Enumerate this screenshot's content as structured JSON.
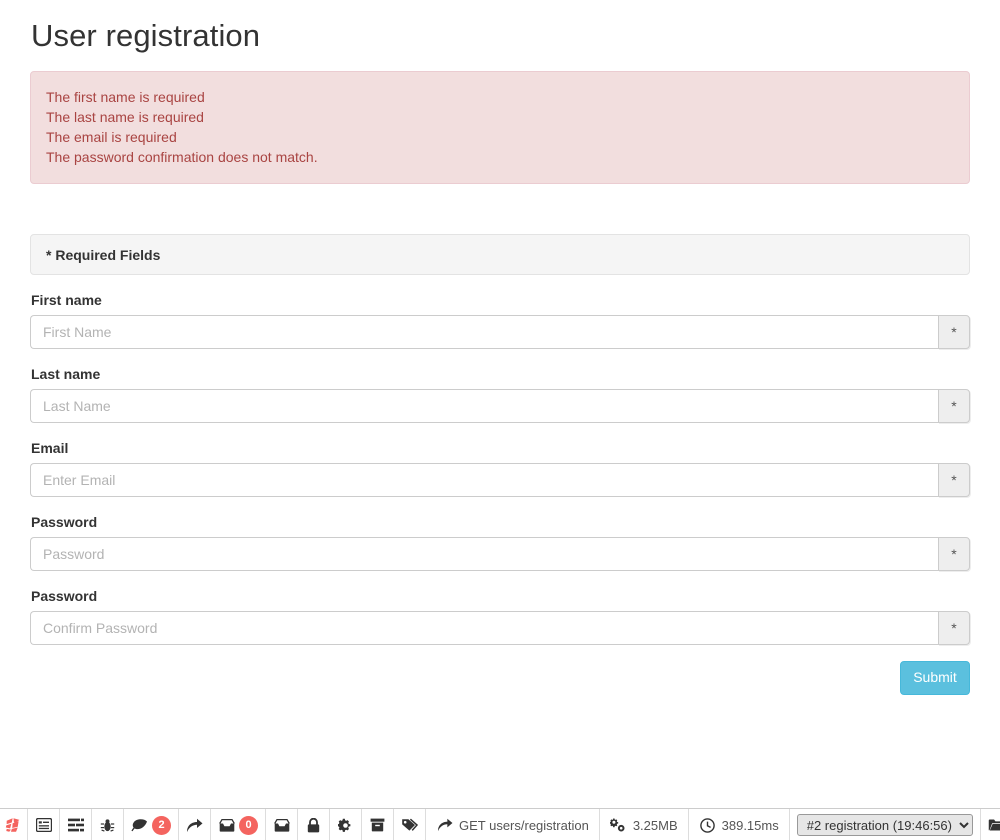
{
  "page": {
    "title": "User registration"
  },
  "alert": {
    "errors": [
      "The first name is required",
      "The last name is required",
      "The email is required",
      "The password confirmation does not match."
    ],
    "bg_color": "#f2dede",
    "text_color": "#a94442"
  },
  "panel": {
    "required_fields_label": "* Required Fields"
  },
  "form": {
    "fields": [
      {
        "label": "First name",
        "placeholder": "First Name",
        "value": "",
        "addon": "*",
        "type": "text",
        "name": "first-name"
      },
      {
        "label": "Last name",
        "placeholder": "Last Name",
        "value": "",
        "addon": "*",
        "type": "text",
        "name": "last-name"
      },
      {
        "label": "Email",
        "placeholder": "Enter Email",
        "value": "",
        "addon": "*",
        "type": "email",
        "name": "email"
      },
      {
        "label": "Password",
        "placeholder": "Password",
        "value": "",
        "addon": "*",
        "type": "password",
        "name": "password"
      },
      {
        "label": "Password",
        "placeholder": "Confirm Password",
        "value": "",
        "addon": "*",
        "type": "password",
        "name": "confirm-password"
      }
    ],
    "submit_label": "Submit",
    "submit_color": "#5bc0de"
  },
  "debugbar": {
    "icons": [
      {
        "name": "debugbar-logo-icon",
        "glyph": "logo",
        "badge": null
      },
      {
        "name": "messages-icon",
        "glyph": "list",
        "badge": null
      },
      {
        "name": "timeline-icon",
        "glyph": "tasks",
        "badge": null
      },
      {
        "name": "exceptions-icon",
        "glyph": "bug",
        "badge": null
      },
      {
        "name": "views-icon",
        "glyph": "leaf",
        "badge": "2"
      },
      {
        "name": "route-icon",
        "glyph": "share",
        "badge": null
      },
      {
        "name": "queries-icon",
        "glyph": "inbox",
        "badge": "0"
      },
      {
        "name": "mails-icon",
        "glyph": "inbox2",
        "badge": null
      },
      {
        "name": "auth-icon",
        "glyph": "lock",
        "badge": null
      },
      {
        "name": "gate-icon",
        "glyph": "gear",
        "badge": null
      },
      {
        "name": "session-icon",
        "glyph": "archive",
        "badge": null
      },
      {
        "name": "request-icon",
        "glyph": "tags",
        "badge": null
      }
    ],
    "route": {
      "icon": "share-icon",
      "label": "GET users/registration"
    },
    "memory": {
      "icon": "cogs-icon",
      "label": "3.25MB"
    },
    "time": {
      "icon": "clock-icon",
      "label": "389.15ms"
    },
    "history_select": {
      "value": "#2 registration (19:46:56)",
      "caret": "▾"
    },
    "open_label": "open-folder-icon",
    "close_label": "close-icon",
    "badge_color": "#f4645f"
  }
}
